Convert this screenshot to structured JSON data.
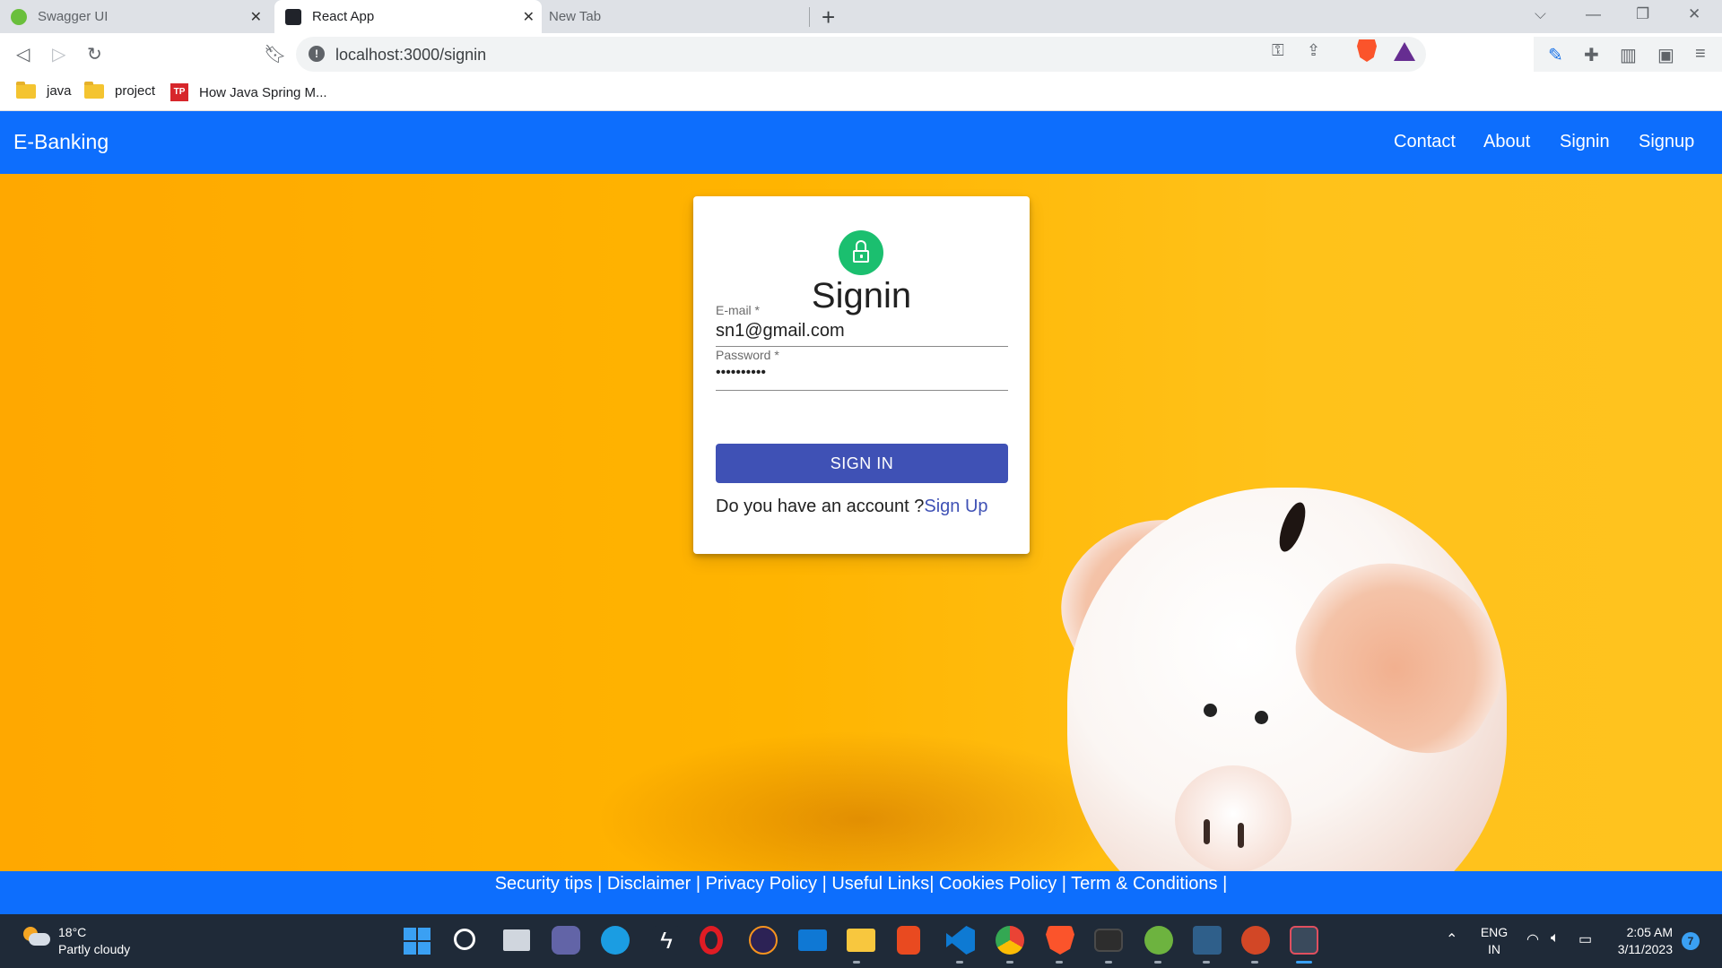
{
  "browser": {
    "tabs": [
      {
        "title": "Swagger UI",
        "active": false
      },
      {
        "title": "React App",
        "active": true
      },
      {
        "title": "New Tab",
        "active": false
      }
    ],
    "new_tab_icon": "plus-icon",
    "address": "localhost:3000/signin",
    "bookmarks": [
      {
        "label": "java",
        "icon": "folder-icon"
      },
      {
        "label": "project",
        "icon": "folder-icon"
      },
      {
        "label": "How Java Spring M...",
        "icon": "tp-icon",
        "icon_text": "TP"
      }
    ]
  },
  "app": {
    "brand": "E-Banking",
    "nav": [
      "Contact",
      "About",
      "Signin",
      "Signup"
    ],
    "signin_card": {
      "title": "Signin",
      "email_label": "E-mail *",
      "email_value": "sn1@gmail.com",
      "password_label": "Password *",
      "password_value": "••••••••••",
      "button_label": "SIGN IN",
      "account_prompt": "Do you have an account ?",
      "signup_link": "Sign Up"
    },
    "footer": "Security tips | Disclaimer | Privacy Policy | Useful Links| Cookies Policy | Term & Conditions |"
  },
  "taskbar": {
    "weather_temp": "18°C",
    "weather_desc": "Partly cloudy",
    "language": "ENG",
    "region": "IN",
    "time": "2:05 AM",
    "date": "3/11/2023",
    "notification_count": "7"
  },
  "colors": {
    "navbar": "#0d6efd",
    "signin_button": "#3f51b5",
    "lock_avatar": "#1bbf6f",
    "hero_background": "#ffb400"
  }
}
